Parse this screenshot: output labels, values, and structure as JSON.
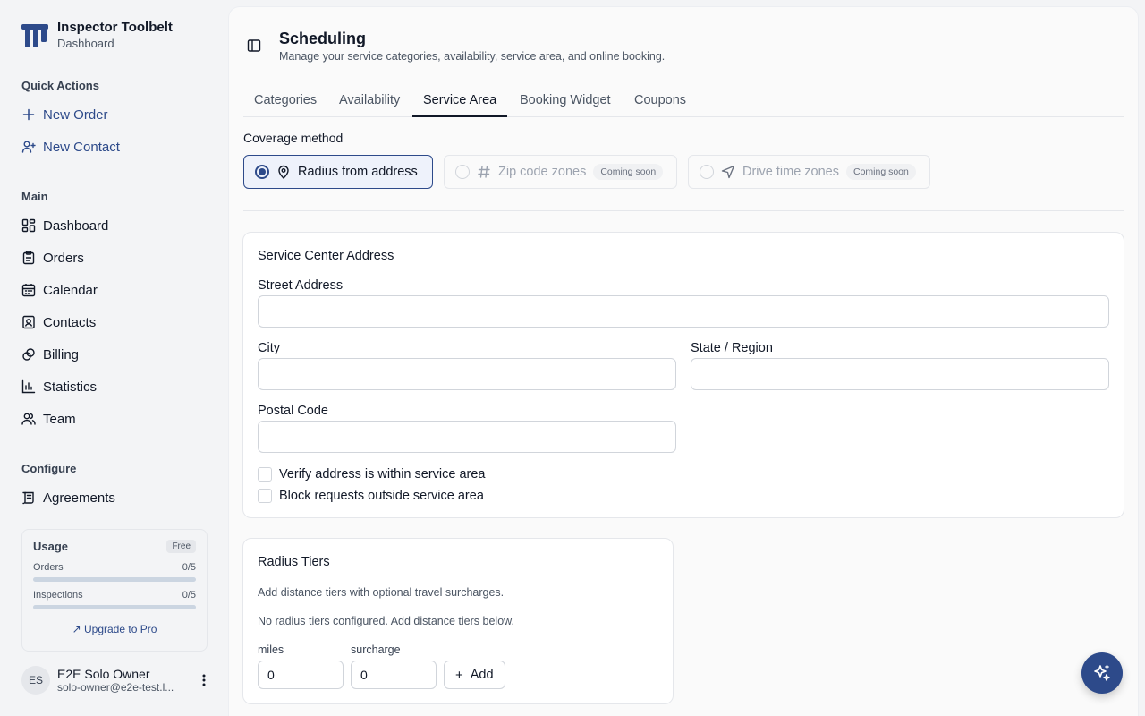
{
  "app": {
    "name": "Inspector Toolbelt",
    "subtitle": "Dashboard",
    "accent": "#2d4a8a"
  },
  "sidebar": {
    "quick_actions_label": "Quick Actions",
    "quick_actions": [
      {
        "label": "New Order",
        "icon": "plus-icon"
      },
      {
        "label": "New Contact",
        "icon": "user-plus-icon"
      }
    ],
    "main_label": "Main",
    "main_items": [
      {
        "label": "Dashboard",
        "icon": "dashboard-icon"
      },
      {
        "label": "Orders",
        "icon": "clipboard-icon"
      },
      {
        "label": "Calendar",
        "icon": "calendar-icon"
      },
      {
        "label": "Contacts",
        "icon": "contact-card-icon"
      },
      {
        "label": "Billing",
        "icon": "billing-icon"
      },
      {
        "label": "Statistics",
        "icon": "bar-chart-icon"
      },
      {
        "label": "Team",
        "icon": "users-icon"
      }
    ],
    "configure_label": "Configure",
    "configure_items": [
      {
        "label": "Agreements",
        "icon": "scroll-icon"
      }
    ],
    "usage": {
      "title": "Usage",
      "plan": "Free",
      "orders_label": "Orders",
      "orders_value": "0/5",
      "orders_fraction": 0,
      "inspections_label": "Inspections",
      "inspections_value": "0/5",
      "inspections_fraction": 0,
      "upgrade_label": "Upgrade to Pro"
    },
    "user": {
      "initials": "ES",
      "name": "E2E Solo Owner",
      "email": "solo-owner@e2e-test.l..."
    }
  },
  "header": {
    "title": "Scheduling",
    "description": "Manage your service categories, availability, service area, and online booking."
  },
  "tabs": [
    {
      "label": "Categories",
      "active": false
    },
    {
      "label": "Availability",
      "active": false
    },
    {
      "label": "Service Area",
      "active": true
    },
    {
      "label": "Booking Widget",
      "active": false
    },
    {
      "label": "Coupons",
      "active": false
    }
  ],
  "coverage": {
    "label": "Coverage method",
    "options": [
      {
        "label": "Radius from address",
        "selected": true,
        "badge": ""
      },
      {
        "label": "Zip code zones",
        "selected": false,
        "badge": "Coming soon"
      },
      {
        "label": "Drive time zones",
        "selected": false,
        "badge": "Coming soon"
      }
    ]
  },
  "address_card": {
    "title": "Service Center Address",
    "street_label": "Street Address",
    "street_value": "",
    "city_label": "City",
    "city_value": "",
    "state_label": "State / Region",
    "state_value": "",
    "postal_label": "Postal Code",
    "postal_value": "",
    "verify_label": "Verify address is within service area",
    "verify_checked": false,
    "block_label": "Block requests outside service area",
    "block_checked": false
  },
  "radius_card": {
    "title": "Radius Tiers",
    "description": "Add distance tiers with optional travel surcharges.",
    "empty_text": "No radius tiers configured. Add distance tiers below.",
    "miles_label": "miles",
    "miles_value": "0",
    "surcharge_label": "surcharge",
    "surcharge_value": "0",
    "add_label": "Add"
  }
}
